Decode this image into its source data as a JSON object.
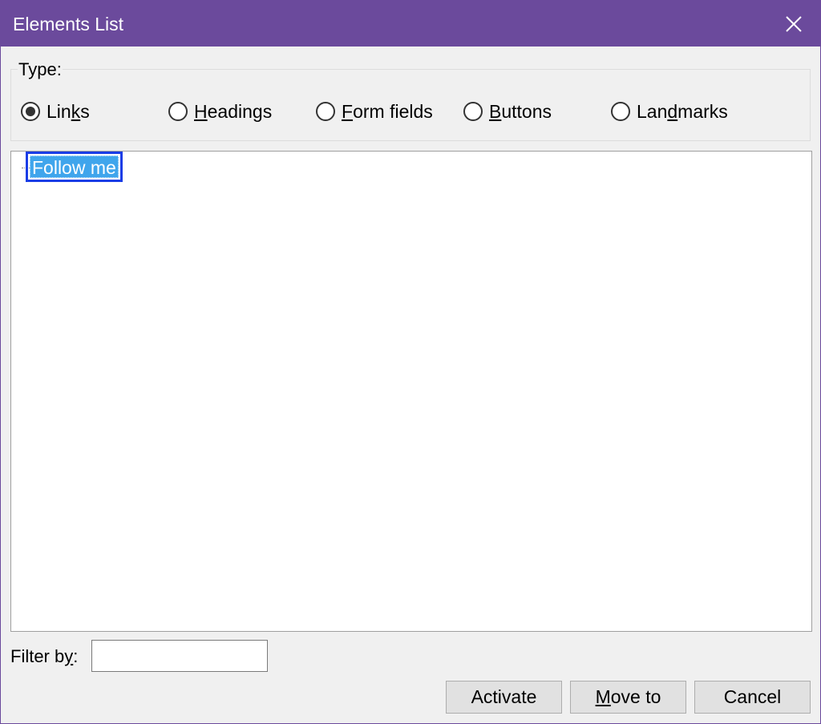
{
  "window": {
    "title": "Elements List"
  },
  "type_group": {
    "legend": "Type:",
    "options": [
      {
        "pre": "Lin",
        "mnemonic": "k",
        "post": "s",
        "checked": true
      },
      {
        "pre": "",
        "mnemonic": "H",
        "post": "eadings",
        "checked": false
      },
      {
        "pre": "",
        "mnemonic": "F",
        "post": "orm fields",
        "checked": false
      },
      {
        "pre": "",
        "mnemonic": "B",
        "post": "uttons",
        "checked": false
      },
      {
        "pre": "Lan",
        "mnemonic": "d",
        "post": "marks",
        "checked": false
      }
    ]
  },
  "list": {
    "items": [
      {
        "label": "Follow me",
        "selected": true
      }
    ]
  },
  "filter": {
    "pre": "Filter b",
    "mnemonic": "y",
    "post": ":",
    "value": ""
  },
  "buttons": {
    "activate": "Activate",
    "move_to": {
      "mnemonic": "M",
      "post": "ove to"
    },
    "cancel": "Cancel"
  },
  "colors": {
    "titlebar": "#6b4a9c",
    "selection": "#3fa5ec",
    "focus_ring": "#1a3de6"
  }
}
